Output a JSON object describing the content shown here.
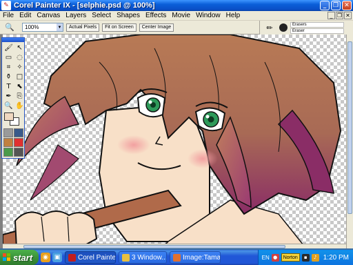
{
  "window": {
    "title": "Corel Painter IX - [selphie.psd @ 100%]",
    "app_icon": "painter-brush-icon"
  },
  "menu": [
    "File",
    "Edit",
    "Canvas",
    "Layers",
    "Select",
    "Shapes",
    "Effects",
    "Movie",
    "Window",
    "Help"
  ],
  "property_bar": {
    "tool_icon": "magnifier-icon",
    "zoom_value": "100%",
    "buttons": [
      "Actual Pixels",
      "Fit on Screen",
      "Center Image"
    ]
  },
  "brush_selector": {
    "category": "Erasers",
    "variant": "Eraser"
  },
  "colors": {
    "main_color": "#f0d8c0",
    "additional_color": "#ffffff",
    "hair": "#b0714d",
    "skin": "#f8e0c8",
    "xp_blue": "#0a5ed8",
    "start_green": "#3c933a"
  },
  "taskbar": {
    "start_label": "start",
    "tasks": [
      {
        "label": "Corel Painte...",
        "active": true
      },
      {
        "label": "3 Window...",
        "active": false
      },
      {
        "label": "Image:Tama...",
        "active": false
      }
    ],
    "language": "EN",
    "norton_label": "Norton",
    "clock": "1:20 PM"
  }
}
